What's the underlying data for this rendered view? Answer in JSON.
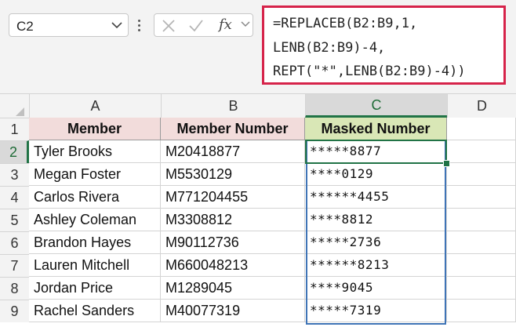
{
  "name_box": {
    "value": "C2"
  },
  "formula_bar": {
    "fx_label": "fx",
    "lines": [
      "=REPLACEB(B2:B9,1,",
      "LENB(B2:B9)-4,",
      "REPT(\"*\",LENB(B2:B9)-4))"
    ]
  },
  "columns": [
    "A",
    "B",
    "C",
    "D"
  ],
  "rows": [
    "1",
    "2",
    "3",
    "4",
    "5",
    "6",
    "7",
    "8",
    "9"
  ],
  "table": {
    "headers": [
      "Member",
      "Member Number",
      "Masked Number"
    ],
    "rows": [
      [
        "Tyler Brooks",
        "M20418877",
        "*****8877"
      ],
      [
        "Megan Foster",
        "M5530129",
        "****0129"
      ],
      [
        "Carlos Rivera",
        "M771204455",
        "******4455"
      ],
      [
        "Ashley Coleman",
        "M3308812",
        "****8812"
      ],
      [
        "Brandon Hayes",
        "M90112736",
        "*****2736"
      ],
      [
        "Lauren Mitchell",
        "M660048213",
        "******8213"
      ],
      [
        "Jordan Price",
        "M1289045",
        "****9045"
      ],
      [
        "Rachel Sanders",
        "M40077319",
        "*****7319"
      ]
    ]
  },
  "colors": {
    "header_member_fill": "#f2dcdb",
    "header_masked_fill": "#d9e7b6",
    "highlight_border": "#d6234a",
    "active_cell_border": "#217346",
    "range_border": "#3f74b6"
  },
  "selection": {
    "active_cell": "C2",
    "active_column": "C",
    "active_row": "2"
  }
}
